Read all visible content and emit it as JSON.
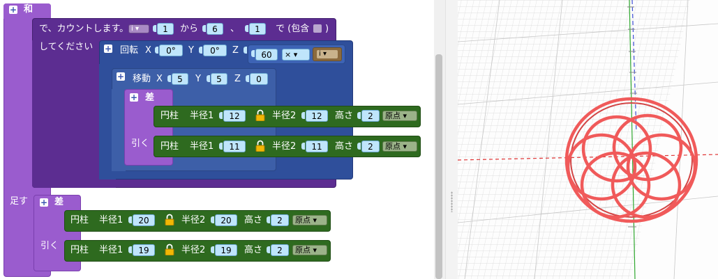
{
  "blocks": {
    "sum": {
      "title": "和",
      "add_label": "足す"
    },
    "loop": {
      "text": "で、カウントします。",
      "var": "i",
      "from": "1",
      "from_label": "から",
      "to": "6",
      "sep": "、",
      "step": "1",
      "incl_label": "で (包含",
      "close": ")",
      "line2": "してください"
    },
    "rotate": {
      "label": "回転",
      "x_label": "X",
      "x": "0°",
      "y_label": "Y",
      "y": "0°",
      "z_label": "Z",
      "z": "60",
      "op": "×",
      "z_var": "i"
    },
    "move": {
      "label": "移動",
      "x_label": "X",
      "x": "5",
      "y_label": "Y",
      "y": "5",
      "z_label": "Z",
      "z": "0"
    },
    "diff1": {
      "title": "差",
      "subtract_label": "引く"
    },
    "diff2": {
      "title": "差",
      "subtract_label": "引く"
    },
    "cyl1": {
      "label": "円柱",
      "r1_label": "半径1",
      "r1": "12",
      "r2_label": "半径2",
      "r2": "12",
      "h_label": "高さ",
      "h": "2",
      "origin": "原点"
    },
    "cyl2": {
      "label": "円柱",
      "r1_label": "半径1",
      "r1": "11",
      "r2_label": "半径2",
      "r2": "11",
      "h_label": "高さ",
      "h": "2",
      "origin": "原点"
    },
    "cyl3": {
      "label": "円柱",
      "r1_label": "半径1",
      "r1": "20",
      "r2_label": "半径2",
      "r2": "20",
      "h_label": "高さ",
      "h": "2",
      "origin": "原点"
    },
    "cyl4": {
      "label": "円柱",
      "r1_label": "半径1",
      "r1": "19",
      "r2_label": "半径2",
      "r2": "19",
      "h_label": "高さ",
      "h": "2",
      "origin": "原点"
    }
  },
  "colors": {
    "purple": "#9a5cce",
    "loop": "#5c2d91",
    "rotate": "#2f4f9b",
    "move": "#3d5fa8",
    "green": "#2e6a1f",
    "shape": "#f05a5a"
  },
  "icons": [
    "plus-icon",
    "lock-icon",
    "dropdown-arrow-icon",
    "checkbox-icon"
  ]
}
